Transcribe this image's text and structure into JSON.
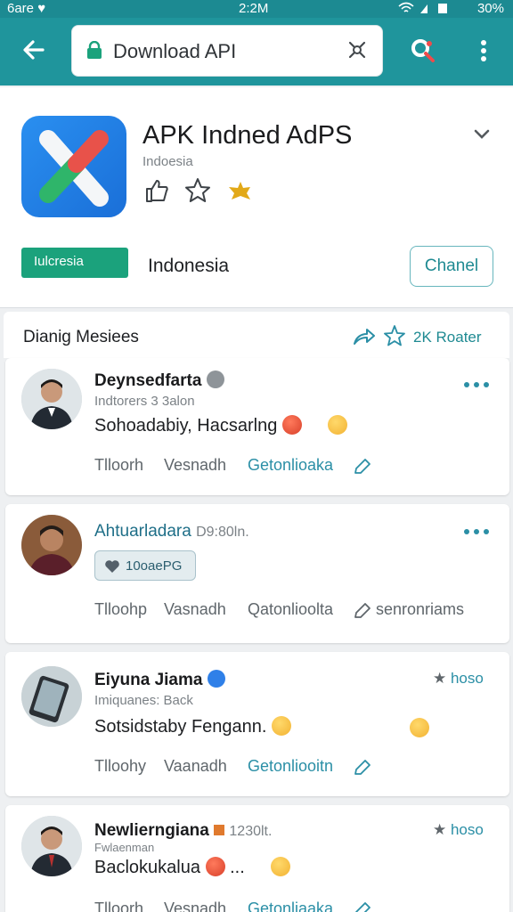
{
  "status_bar": {
    "left": "6are ♥",
    "time": "2:2M",
    "right": "30%",
    "icons": "wifi ◢ ▮"
  },
  "toolbar": {
    "url_text": "Download API",
    "back_icon": "arrow-left-icon",
    "lock_icon": "lock-icon",
    "search_icon": "search-icon",
    "menu_icon": "more-vert-icon"
  },
  "app": {
    "title": "APK Indned AdPS",
    "subtitle": "Indoesia",
    "region_chip": "Iulcresia",
    "region_label": "Indonesia",
    "channel_button": "Chanel"
  },
  "section": {
    "title": "Dianig Mesiees",
    "action_text": "2K Roater"
  },
  "messages": [
    {
      "name": "Deynsedfarta",
      "meta": "Indtorers 3 3alon",
      "body": "Sohoadabiy, Hacsarlng",
      "actions": [
        "Tlloorh",
        "Vesnadh",
        "Getonlioaka"
      ],
      "verified": "gray"
    },
    {
      "name": "Ahtuarladara",
      "name_suffix": "D9:80ln.",
      "reply_chip": "10oaePG",
      "actions": [
        "Tlloohp",
        "Vasnadh",
        "Qatonlioolta",
        "senronriams"
      ]
    },
    {
      "name": "Eiyuna Jiama",
      "meta": "Imiquanes: Back",
      "body": "Sotsidstaby Fengann.",
      "tag": "hoso",
      "actions": [
        "Tlloohy",
        "Vaanadh",
        "Getonliooitn"
      ],
      "verified": "blue"
    },
    {
      "name": "Newlierngiana",
      "name_suffix": "1230lt.",
      "meta": "Fwlaenman",
      "body": "Baclokukalua",
      "body_suffix": "...",
      "tag": "hoso",
      "actions": [
        "Tlloorh",
        "Vesnadh",
        "Getonliaaka"
      ]
    }
  ],
  "colors": {
    "status_bar": "#1c8a92",
    "toolbar": "#1f959c",
    "accent": "#2b8fa6",
    "chip_green": "#1ba27c"
  }
}
